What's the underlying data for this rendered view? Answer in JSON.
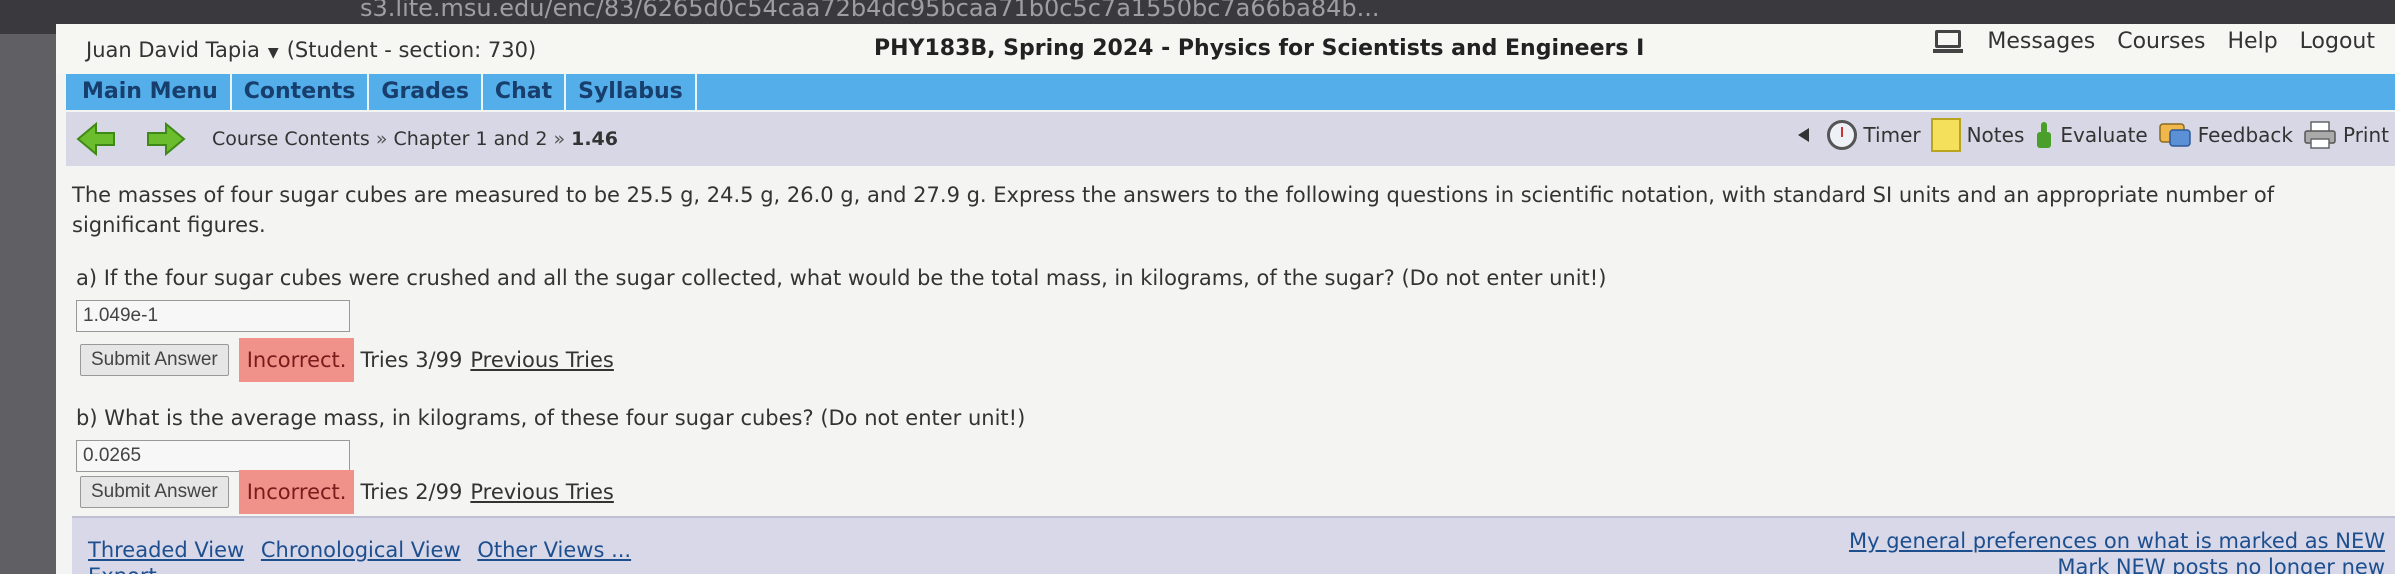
{
  "browser": {
    "url_text": "s3.lite.msu.edu/enc/83/6265d0c54caa72b4dc95bcaa71b0c5c7a1550bc7a66ba84b..."
  },
  "header": {
    "user_name": "Juan David Tapia",
    "user_section": "(Student  - section: 730)",
    "course_title": "PHY183B, Spring 2024 - Physics for Scientists and Engineers I",
    "links": [
      "Messages",
      "Courses",
      "Help",
      "Logout"
    ]
  },
  "menu": [
    "Main Menu",
    "Contents",
    "Grades",
    "Chat",
    "Syllabus"
  ],
  "breadcrumb": {
    "items": [
      "Course Contents",
      "Chapter 1 and 2"
    ],
    "separator": "»",
    "current": "1.46"
  },
  "tools": {
    "timer": "Timer",
    "notes": "Notes",
    "evaluate": "Evaluate",
    "feedback": "Feedback",
    "print": "Print"
  },
  "problem": {
    "text": "The masses of four sugar cubes are measured to be 25.5 g, 24.5 g, 26.0 g, and 27.9 g. Express the answers to the following questions in scientific notation, with standard SI units and an appropriate number of significant figures.",
    "parts": [
      {
        "question": "a) If the four sugar cubes were crushed and all the sugar collected, what would be the total mass, in kilograms, of the sugar? (Do not enter unit!)",
        "answer": "1.049e-1",
        "submit_label": "Submit Answer",
        "status": "Incorrect.",
        "tries": "Tries 3/99",
        "previous_link": "Previous Tries"
      },
      {
        "question": "b) What is the average mass, in kilograms, of these four sugar cubes? (Do not enter unit!)",
        "answer": "0.0265",
        "submit_label": "Submit Answer",
        "status": "Incorrect.",
        "tries": "Tries 2/99",
        "previous_link": "Previous Tries"
      }
    ]
  },
  "discussion": {
    "views": [
      "Threaded View",
      "Chronological View",
      "Other Views ..."
    ],
    "export": "Export",
    "preferences": "My general preferences on what is marked as NEW",
    "mark_new": "Mark NEW posts no longer new"
  },
  "colors": {
    "menu_bg": "#53aee9",
    "nav_bg": "#d7d7e6",
    "incorrect_bg": "#f0918a",
    "link": "#1d4f8f"
  }
}
